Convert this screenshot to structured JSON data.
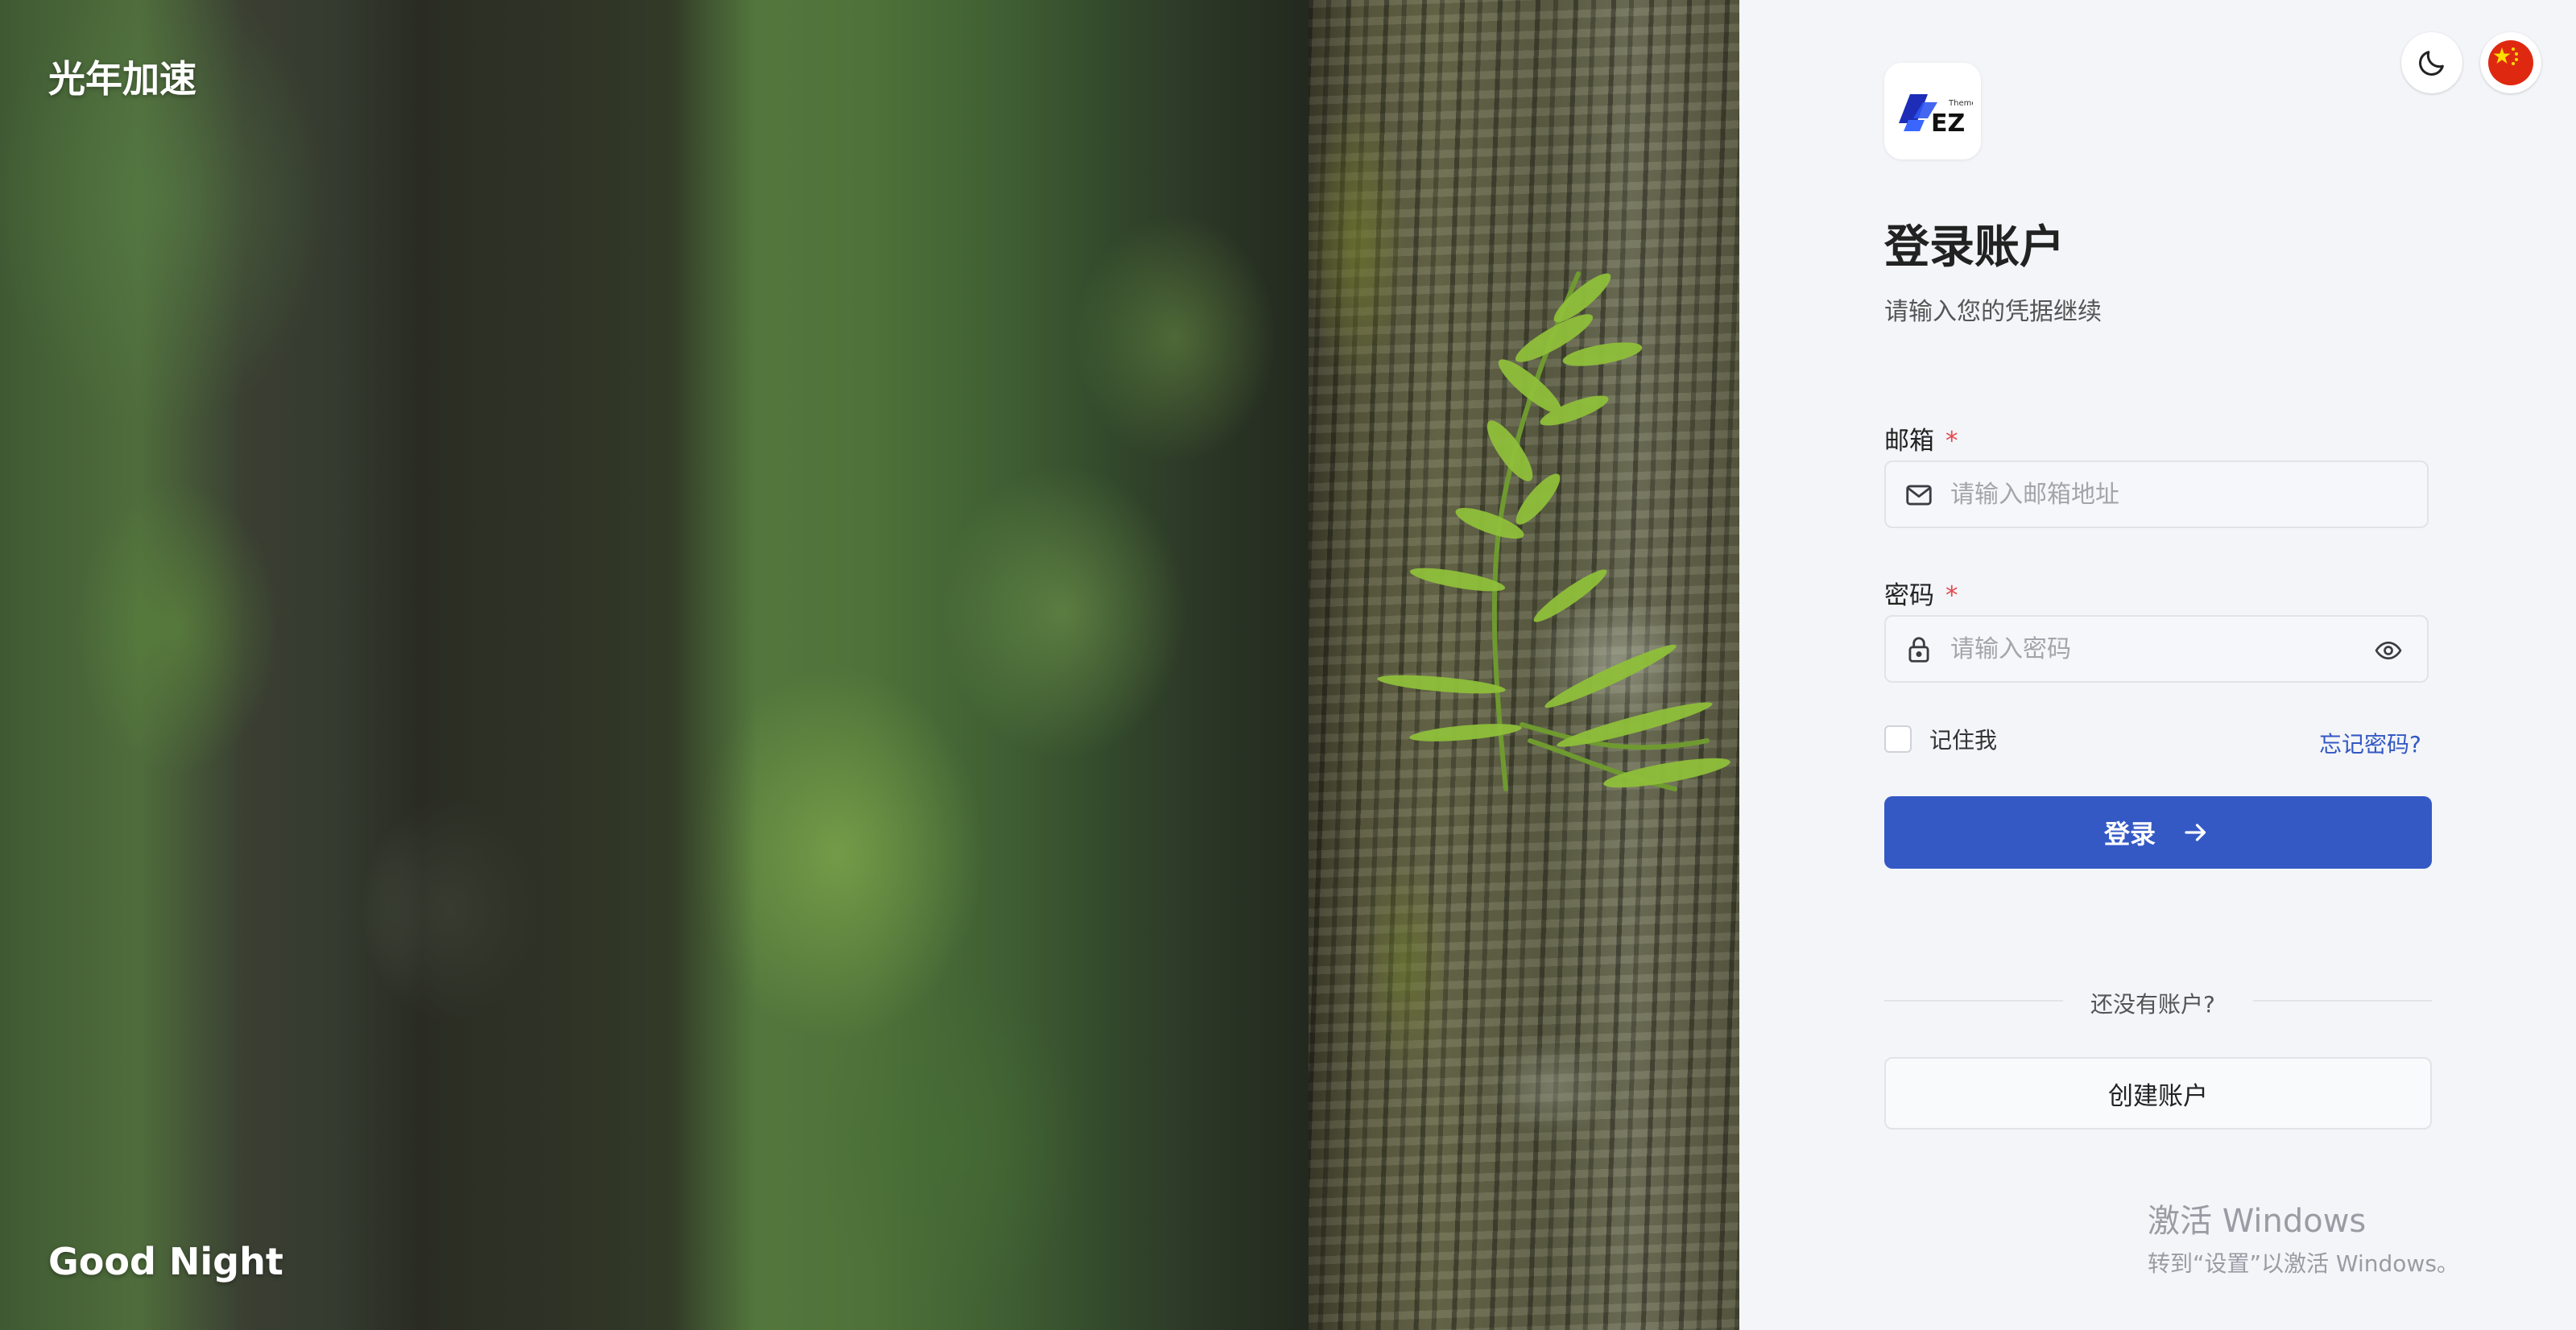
{
  "hero": {
    "brand": "光年加速",
    "greeting": "Good Night"
  },
  "toolbar": {
    "theme_icon": "moon-icon",
    "language_icon": "china-flag-icon"
  },
  "logo": {
    "text": "EZ",
    "tag": "Theme"
  },
  "login": {
    "title": "登录账户",
    "subtitle": "请输入您的凭据继续",
    "email_label": "邮箱",
    "email_required": "*",
    "email_placeholder": "请输入邮箱地址",
    "email_value": "",
    "password_label": "密码",
    "password_required": "*",
    "password_placeholder": "请输入密码",
    "password_value": "",
    "remember_label": "记住我",
    "remember_checked": false,
    "forgot_label": "忘记密码?",
    "submit_label": "登录",
    "no_account_text": "还没有账户?",
    "create_label": "创建账户"
  },
  "watermark": {
    "title": "激活 Windows",
    "subtitle": "转到“设置”以激活 Windows。"
  },
  "colors": {
    "primary": "#3459c5",
    "link": "#3358c4",
    "required": "#e5484d",
    "panel_bg": "#f4f5f9"
  }
}
